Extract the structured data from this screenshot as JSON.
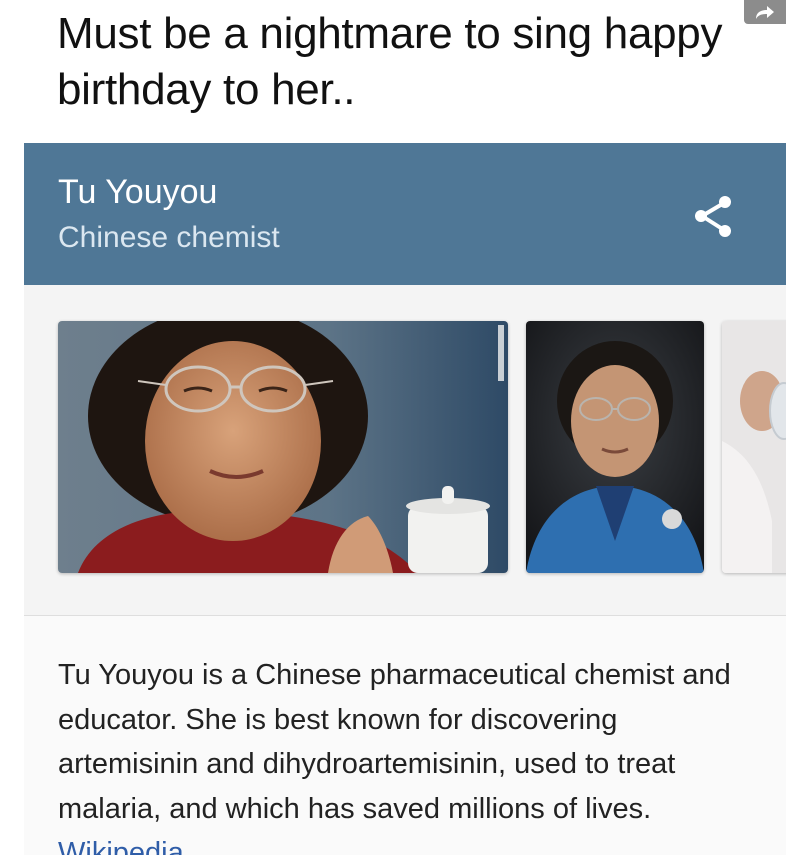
{
  "post": {
    "caption": "Must be a nightmare to sing happy birthday to her.."
  },
  "knowledge_card": {
    "title": "Tu Youyou",
    "subtitle": "Chinese chemist",
    "share_icon": "share-icon",
    "description": "Tu Youyou is a Chinese pharmaceutical chemist and educator. She is best known for discovering artemisinin and dihydroartemisinin, used to treat malaria, and which has saved millions of lives.",
    "source_link": "Wikipedia"
  },
  "colors": {
    "header_bg": "#4f7796",
    "header_title": "#ffffff",
    "header_subtitle": "#dbe7f0",
    "link": "#2f5da8"
  }
}
